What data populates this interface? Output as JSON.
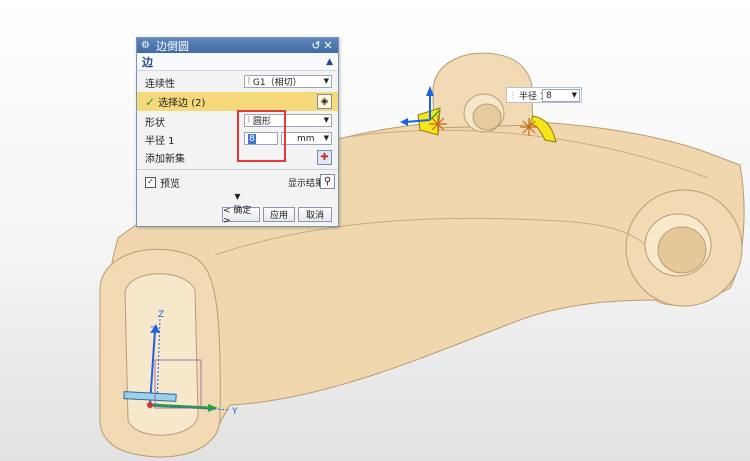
{
  "dialog": {
    "title": "边倒圆",
    "section_edge": "边",
    "continuity_label": "连续性",
    "continuity_value": "G1（相切）",
    "selected_edges": "选择边 (2)",
    "shape_label": "形状",
    "shape_value": "圆形",
    "radius_label": "半径 1",
    "radius_value": "8",
    "radius_unit": "mm",
    "add_set_label": "添加新集",
    "preview_label": "预览",
    "show_result": "显示结果",
    "ok": "< 确定 >",
    "apply": "应用",
    "cancel": "取消"
  },
  "popup": {
    "label": "半径 1",
    "value": "8"
  },
  "axes": {
    "z": "Z",
    "z2": "Z",
    "y": "Y"
  },
  "icons": {
    "title": "gear-icon",
    "reset": "reset-icon",
    "close": "close-icon",
    "collapse": "chevron-up-icon",
    "continuity": "curve-icon",
    "edge_select": "cube-select-icon",
    "add_set": "add-set-icon",
    "show_result": "magnifier-icon",
    "more": "chevron-down-icon"
  },
  "colors": {
    "part": "#f0d7ae",
    "part_edge": "#b89c72",
    "highlight": "#f5d97a",
    "fillet": "#f5e51a",
    "callout_red": "#e23a3a",
    "axis_blue": "#1c62e0",
    "axis_green": "#2aa13f"
  }
}
